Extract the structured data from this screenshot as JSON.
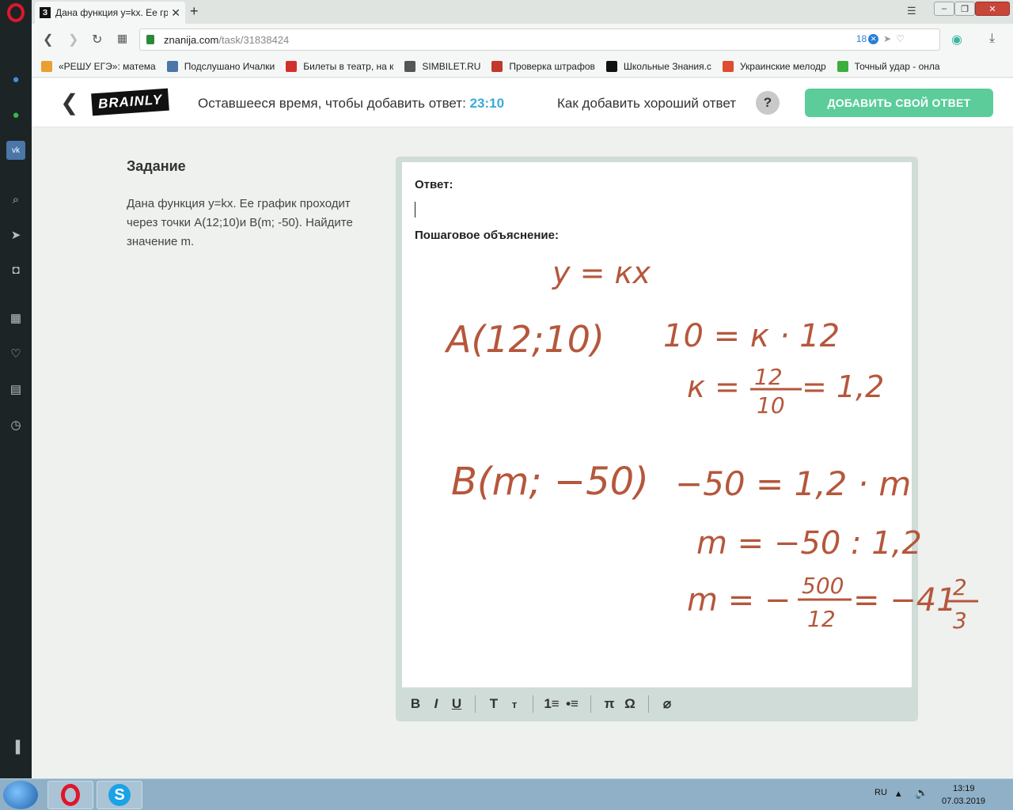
{
  "browser": {
    "tab_title": "Дана функция y=kx. Ее гр",
    "tab_favicon": "З",
    "url_domain": "znanija.com",
    "url_path": "/task/31838424",
    "notification_count": "18",
    "bookmarks": [
      {
        "label": "«РЕШУ ЕГЭ»: матема",
        "color": "#e8a030"
      },
      {
        "label": "Подслушано Ичалки",
        "color": "#4a76a8"
      },
      {
        "label": "Билеты в театр, на к",
        "color": "#d0312d"
      },
      {
        "label": "SIMBILET.RU",
        "color": "#555555"
      },
      {
        "label": "Проверка штрафов",
        "color": "#c0392b"
      },
      {
        "label": "Школьные Знания.c",
        "color": "#111111"
      },
      {
        "label": "Украинские мелодр",
        "color": "#e04c2f"
      },
      {
        "label": "Точный удар - онла",
        "color": "#3cae3c"
      }
    ]
  },
  "header": {
    "timer_label": "Оставшееся время, чтобы добавить ответ:",
    "timer_value": "23:10",
    "howto_label": "Как добавить хороший ответ",
    "help_symbol": "?",
    "add_button": "ДОБАВИТЬ СВОЙ ОТВЕТ",
    "logo": "BRAINLY"
  },
  "task": {
    "heading": "Задание",
    "body": "Дана функция y=kx. Ее график проходит через точки A(12;10)и B(m; -50). Найдите значение m."
  },
  "editor": {
    "answer_label": "Ответ:",
    "explanation_label": "Пошаговое объяснение:",
    "handwriting": {
      "ink_color": "#b5573c",
      "line1": "y = кх",
      "point_a": "A(12;10)",
      "eq1": "10 = к · 12",
      "k_lhs": "к =",
      "k_num": "12",
      "k_den": "10",
      "k_rhs": "= 1,2",
      "point_b": "B(m; −50)",
      "eq2": "−50 = 1,2 · m",
      "eq3": "m = −50 : 1,2",
      "m_lhs": "m = −",
      "m_num": "500",
      "m_den": "12",
      "m_mid": "= −41",
      "m_frac_num": "2",
      "m_frac_den": "3"
    },
    "toolbar": [
      "B",
      "I",
      "U",
      "T",
      "т",
      "1≡",
      "•≡",
      "π",
      "Ω",
      "⌀"
    ]
  },
  "taskbar": {
    "lang": "RU",
    "time": "13:19",
    "date": "07.03.2019"
  }
}
